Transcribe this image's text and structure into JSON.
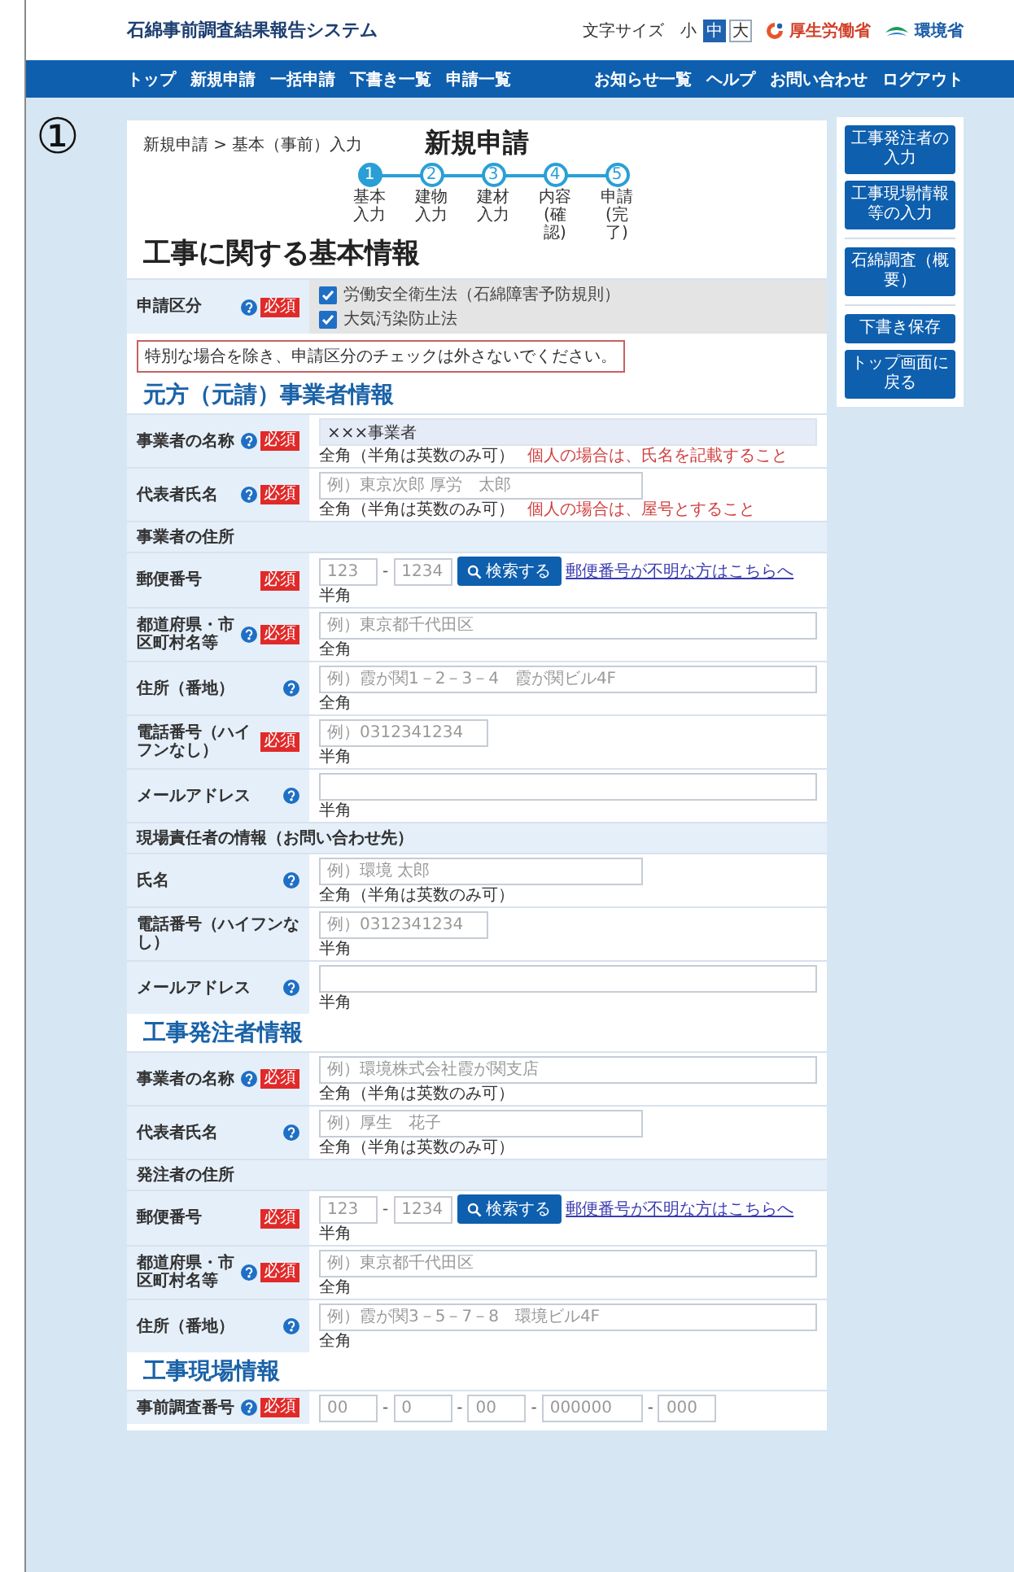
{
  "header": {
    "title": "石綿事前調査結果報告システム",
    "font_size": {
      "label": "文字サイズ",
      "options": [
        {
          "label": "小",
          "selected": false
        },
        {
          "label": "中",
          "selected": true
        },
        {
          "label": "大",
          "selected": false
        }
      ]
    },
    "logos": [
      {
        "kind": "ministry-health",
        "label": "厚生労働省"
      },
      {
        "kind": "ministry-env",
        "label": "環境省"
      }
    ]
  },
  "nav": {
    "left": [
      "トップ",
      "新規申請",
      "一括申請",
      "下書き一覧",
      "申請一覧"
    ],
    "right": [
      "お知らせ一覧",
      "ヘルプ",
      "お問い合わせ",
      "ログアウト"
    ]
  },
  "annotation": "①",
  "breadcrumb": "新規申請 > 基本（事前）入力",
  "title": "新規申請",
  "steps": [
    {
      "number": "1",
      "label": "基本入力",
      "selected": true
    },
    {
      "number": "2",
      "label": "建物入力",
      "selected": false
    },
    {
      "number": "3",
      "label": "建材入力",
      "selected": false
    },
    {
      "number": "4",
      "label": "内容(確認)",
      "selected": false
    },
    {
      "number": "5",
      "label": "申請(完了)",
      "selected": false
    }
  ],
  "page_heading": "工事に関する基本情報",
  "application_type": {
    "label": "申請区分",
    "help": true,
    "required": "必須",
    "options": [
      {
        "label": "労働安全衛生法（石綿障害予防規則）",
        "checked": true
      },
      {
        "label": "大気汚染防止法",
        "checked": true
      }
    ]
  },
  "warning": "特別な場合を除き、申請区分のチェックは外さないでください。",
  "sections": [
    {
      "title": "元方（元請）事業者情報",
      "rows": [
        {
          "kind": "text",
          "label": "事業者の名称",
          "help": true,
          "required": "必須",
          "value": "×××事業者",
          "readonly": true,
          "hint": "全角（半角は英数のみ可）",
          "note": "個人の場合は、氏名を記載すること"
        },
        {
          "kind": "name",
          "label": "代表者氏名",
          "help": true,
          "required": "必須",
          "placeholder": "例）東京次郎 厚労　太郎",
          "readonly": false,
          "hint": "全角（半角は英数のみ可）",
          "note": "個人の場合は、屋号とすること"
        },
        {
          "kind": "subheading",
          "label": "事業者の住所"
        },
        {
          "kind": "postal",
          "label": "郵便番号",
          "help": false,
          "required": "必須",
          "parts": [
            {
              "placeholder": "123"
            },
            {
              "placeholder": "1234"
            }
          ],
          "separator": "-",
          "button": "検索する",
          "link": "郵便番号が不明な方はこちらへ",
          "hint": "半角"
        },
        {
          "kind": "text",
          "label": "都道府県・市区町村名等",
          "help": true,
          "required": "必須",
          "placeholder": "例）東京都千代田区",
          "readonly": false,
          "hint": "全角"
        },
        {
          "kind": "text",
          "label": "住所（番地）",
          "help": true,
          "placeholder": "例）霞が関1－2－3－4　霞が関ビル4F",
          "readonly": false,
          "hint": "全角"
        },
        {
          "kind": "phone",
          "label": "電話番号（ハイフンなし）",
          "help": false,
          "required": "必須",
          "placeholder": "例）0312341234",
          "readonly": false,
          "hint": "半角"
        },
        {
          "kind": "text",
          "label": "メールアドレス",
          "help": true,
          "readonly": false,
          "hint": "半角"
        },
        {
          "kind": "subheading",
          "label": "現場責任者の情報（お問い合わせ先）"
        },
        {
          "kind": "name",
          "label": "氏名",
          "help": true,
          "placeholder": "例）環境 太郎",
          "readonly": false,
          "hint": "全角（半角は英数のみ可）"
        },
        {
          "kind": "phone",
          "label": "電話番号（ハイフンなし）",
          "help": false,
          "placeholder": "例）0312341234",
          "readonly": false,
          "hint": "半角"
        },
        {
          "kind": "text",
          "label": "メールアドレス",
          "help": true,
          "readonly": false,
          "hint": "半角"
        }
      ]
    },
    {
      "title": "工事発注者情報",
      "rows": [
        {
          "kind": "text",
          "label": "事業者の名称",
          "help": true,
          "required": "必須",
          "placeholder": "例）環境株式会社霞が関支店",
          "readonly": false,
          "hint": "全角（半角は英数のみ可）"
        },
        {
          "kind": "name",
          "label": "代表者氏名",
          "help": true,
          "placeholder": "例）厚生　花子",
          "readonly": false,
          "hint": "全角（半角は英数のみ可）"
        },
        {
          "kind": "subheading",
          "label": "発注者の住所"
        },
        {
          "kind": "postal",
          "label": "郵便番号",
          "help": false,
          "required": "必須",
          "parts": [
            {
              "placeholder": "123"
            },
            {
              "placeholder": "1234"
            }
          ],
          "separator": "-",
          "button": "検索する",
          "link": "郵便番号が不明な方はこちらへ",
          "hint": "半角"
        },
        {
          "kind": "text",
          "label": "都道府県・市区町村名等",
          "help": true,
          "required": "必須",
          "placeholder": "例）東京都千代田区",
          "readonly": false,
          "hint": "全角"
        },
        {
          "kind": "text",
          "label": "住所（番地）",
          "help": true,
          "placeholder": "例）霞が関3－5－7－8　環境ビル4F",
          "readonly": false,
          "hint": "全角"
        }
      ]
    },
    {
      "title": "工事現場情報",
      "rows": [
        {
          "kind": "segments",
          "label": "事前調査番号",
          "help": true,
          "required": "必須",
          "parts": [
            {
              "placeholder": "00"
            },
            {
              "placeholder": "0"
            },
            {
              "placeholder": "00"
            },
            {
              "placeholder": "000000"
            },
            {
              "placeholder": "000"
            }
          ],
          "separator": "-"
        }
      ]
    }
  ],
  "sidebar": [
    [
      "工事発注者の入力",
      "工事現場情報等の入力"
    ],
    [
      "石綿調査（概要）"
    ],
    [
      "下書き保存",
      "トップ画面に戻る"
    ]
  ]
}
